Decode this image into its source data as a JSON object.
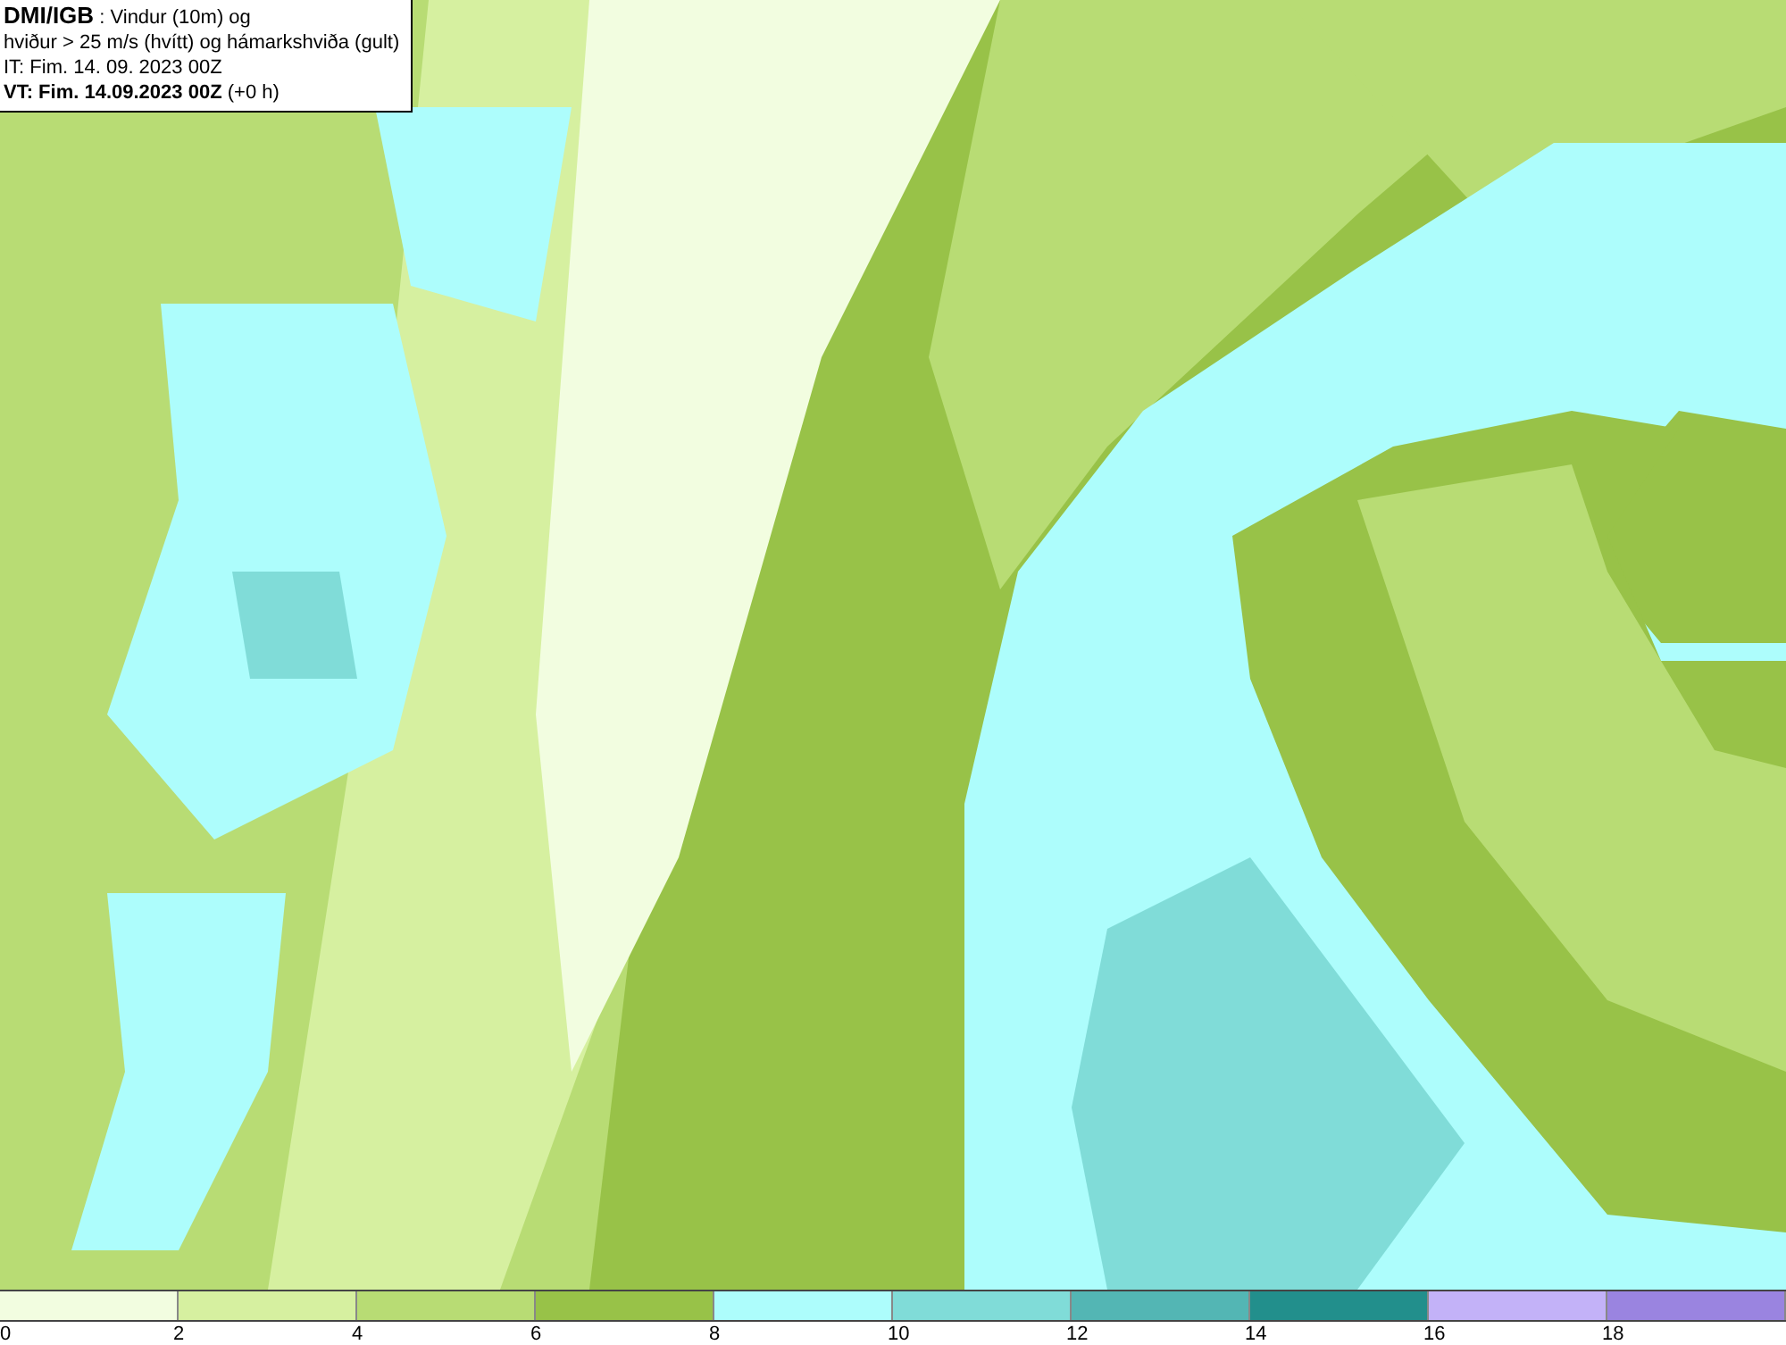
{
  "info_box": {
    "lines": [
      "**DMI/IGB** : Vindur (10m) og",
      "hviður > 25 m/s (hvítt) og hámarkshviða (gult)",
      "IT: Fim. 14. 09. 2023 00Z",
      "**VT: Fim. 14.09.2023 00Z** (+0 h)"
    ]
  },
  "legend": {
    "bins": [
      {
        "color": "#f2fde0"
      },
      {
        "color": "#d6f0a0"
      },
      {
        "color": "#b8dc74"
      },
      {
        "color": "#98c248"
      },
      {
        "color": "#adfdfc"
      },
      {
        "color": "#80dcd8"
      },
      {
        "color": "#53b6b4"
      },
      {
        "color": "#228f8c"
      },
      {
        "color": "#c3b2f8"
      },
      {
        "color": "#9a84e0"
      }
    ],
    "ticks": [
      "0",
      "2",
      "4",
      "6",
      "8",
      "10",
      "12",
      "14",
      "16",
      "18"
    ]
  }
}
